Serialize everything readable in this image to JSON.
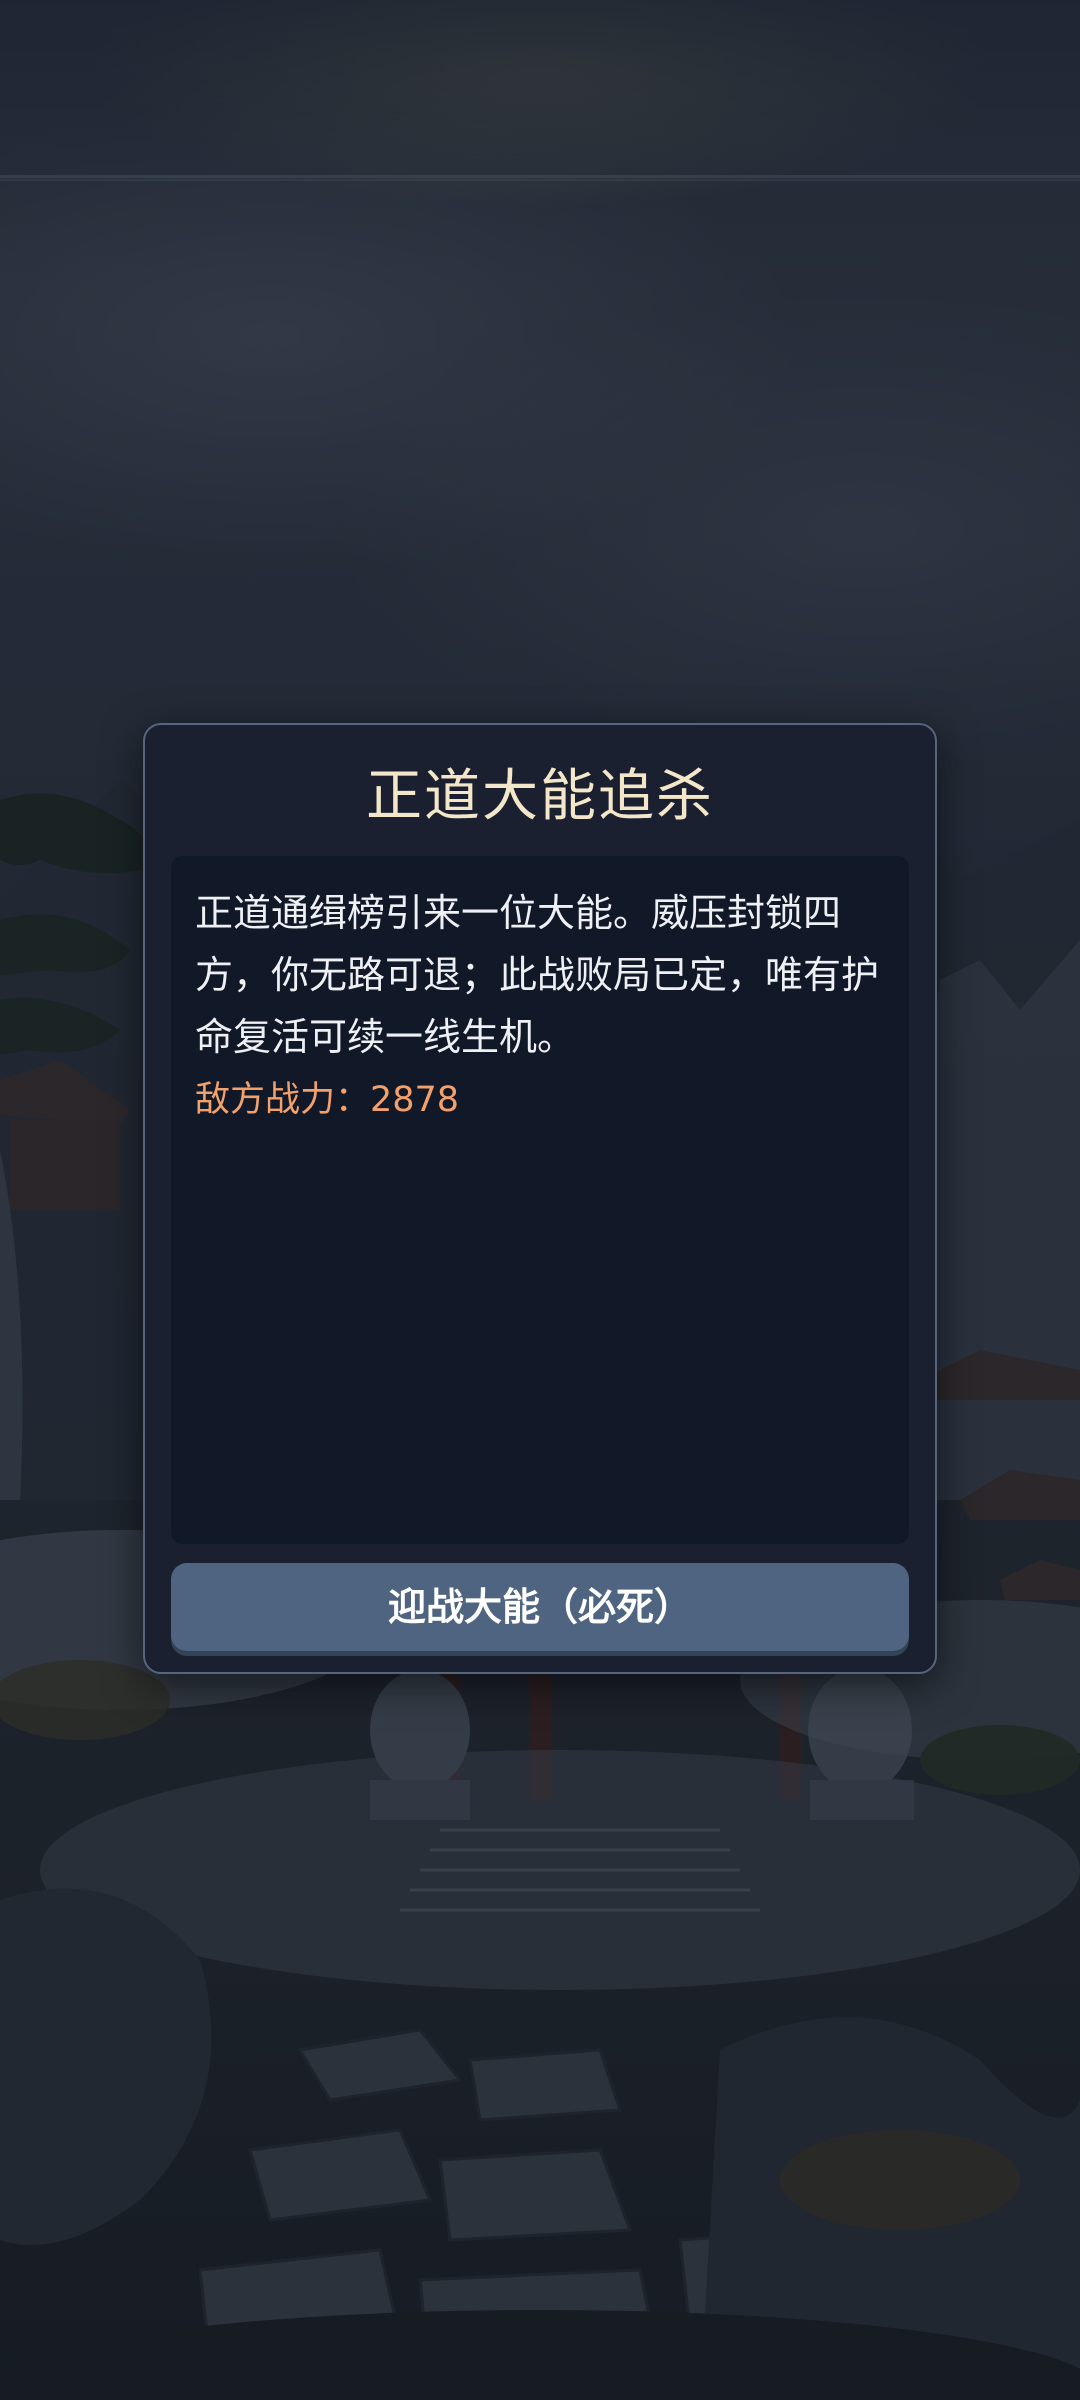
{
  "dialog": {
    "title": "正道大能追杀",
    "body": "正道通缉榜引来一位大能。威压封锁四方，你无路可退；此战败局已定，唯有护命复活可续一线生机。",
    "enemy_power_label": "敌方战力：2878",
    "button_label": "迎战大能（必死）"
  },
  "colors": {
    "title": "#f4e7c9",
    "body_text": "#eef0f4",
    "enemy_power": "#f2a06c",
    "button_bg": "#4f6480",
    "modal_bg": "#1a2030",
    "modal_border": "#56657e"
  }
}
